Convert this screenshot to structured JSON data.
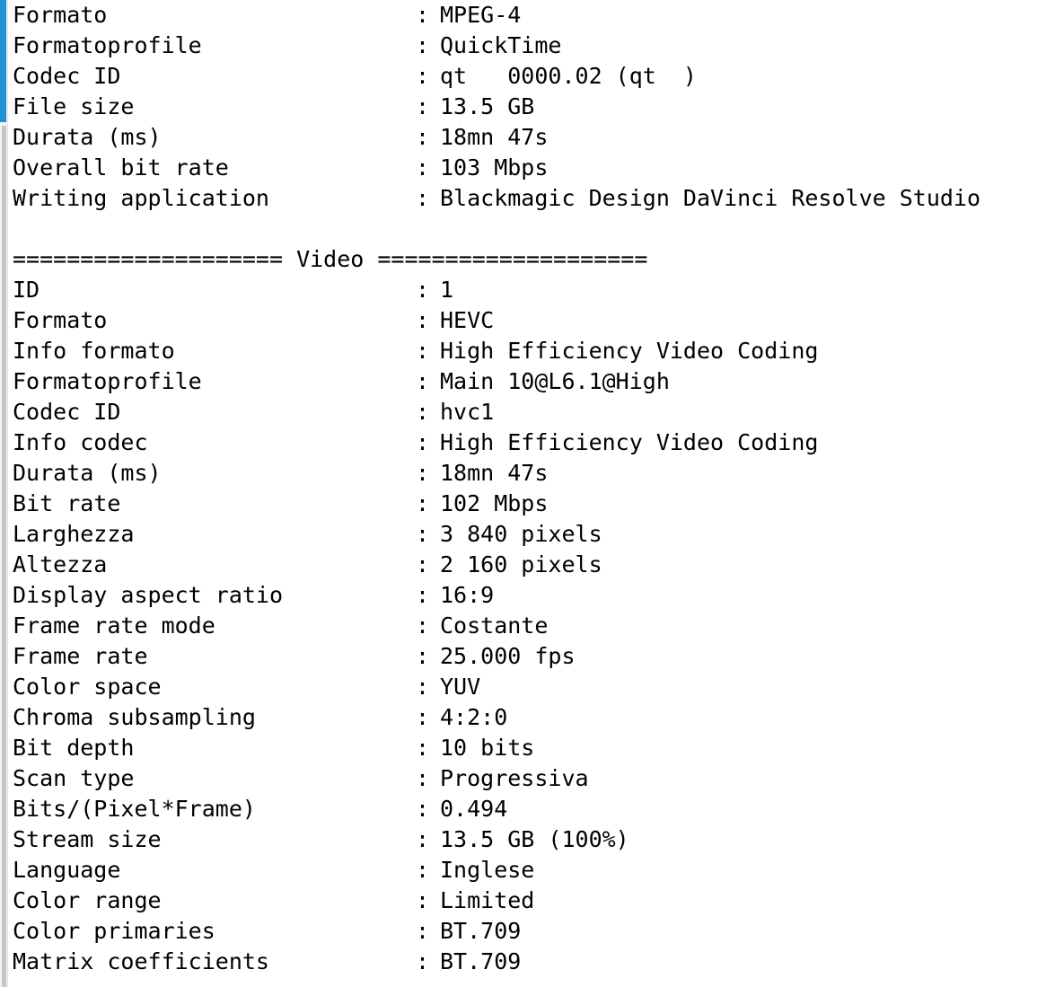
{
  "panel": {
    "type": "mediainfo-text-output",
    "scrollbar": {
      "name": "vertical-scrollbar",
      "thumb_color": "#1f8fd6",
      "track_color": "#f4f4f4",
      "lower_color": "#c6c6c6",
      "orientation": "vertical",
      "position": "left"
    },
    "separator": ":",
    "text_color": "#000000",
    "background_color": "#ffffff"
  },
  "lines": [
    {
      "kind": "pair",
      "label": "Formato",
      "value": "MPEG-4"
    },
    {
      "kind": "pair",
      "label": "Formatoprofile",
      "value": "QuickTime"
    },
    {
      "kind": "pair",
      "label": "Codec ID",
      "value": "qt   0000.02 (qt  )"
    },
    {
      "kind": "pair",
      "label": "File size",
      "value": "13.5 GB"
    },
    {
      "kind": "pair",
      "label": "Durata (ms)",
      "value": "18mn 47s"
    },
    {
      "kind": "pair",
      "label": "Overall bit rate",
      "value": "103 Mbps"
    },
    {
      "kind": "pair",
      "label": "Writing application",
      "value": "Blackmagic Design DaVinci Resolve Studio"
    },
    {
      "kind": "blank"
    },
    {
      "kind": "divider",
      "text": "==================== Video ===================="
    },
    {
      "kind": "pair",
      "label": "ID",
      "value": "1"
    },
    {
      "kind": "pair",
      "label": "Formato",
      "value": "HEVC"
    },
    {
      "kind": "pair",
      "label": "Info formato",
      "value": "High Efficiency Video Coding"
    },
    {
      "kind": "pair",
      "label": "Formatoprofile",
      "value": "Main 10@L6.1@High"
    },
    {
      "kind": "pair",
      "label": "Codec ID",
      "value": "hvc1"
    },
    {
      "kind": "pair",
      "label": "Info codec",
      "value": "High Efficiency Video Coding"
    },
    {
      "kind": "pair",
      "label": "Durata (ms)",
      "value": "18mn 47s"
    },
    {
      "kind": "pair",
      "label": "Bit rate",
      "value": "102 Mbps"
    },
    {
      "kind": "pair",
      "label": "Larghezza",
      "value": "3 840 pixels"
    },
    {
      "kind": "pair",
      "label": "Altezza",
      "value": "2 160 pixels"
    },
    {
      "kind": "pair",
      "label": "Display aspect ratio",
      "value": "16:9"
    },
    {
      "kind": "pair",
      "label": "Frame rate mode",
      "value": "Costante"
    },
    {
      "kind": "pair",
      "label": "Frame rate",
      "value": "25.000 fps"
    },
    {
      "kind": "pair",
      "label": "Color space",
      "value": "YUV"
    },
    {
      "kind": "pair",
      "label": "Chroma subsampling",
      "value": "4:2:0"
    },
    {
      "kind": "pair",
      "label": "Bit depth",
      "value": "10 bits"
    },
    {
      "kind": "pair",
      "label": "Scan type",
      "value": "Progressiva"
    },
    {
      "kind": "pair",
      "label": "Bits/(Pixel*Frame)",
      "value": "0.494"
    },
    {
      "kind": "pair",
      "label": "Stream size",
      "value": "13.5 GB (100%)"
    },
    {
      "kind": "pair",
      "label": "Language",
      "value": "Inglese"
    },
    {
      "kind": "pair",
      "label": "Color range",
      "value": "Limited"
    },
    {
      "kind": "pair",
      "label": "Color primaries",
      "value": "BT.709"
    },
    {
      "kind": "pair",
      "label": "Matrix coefficients",
      "value": "BT.709"
    }
  ]
}
